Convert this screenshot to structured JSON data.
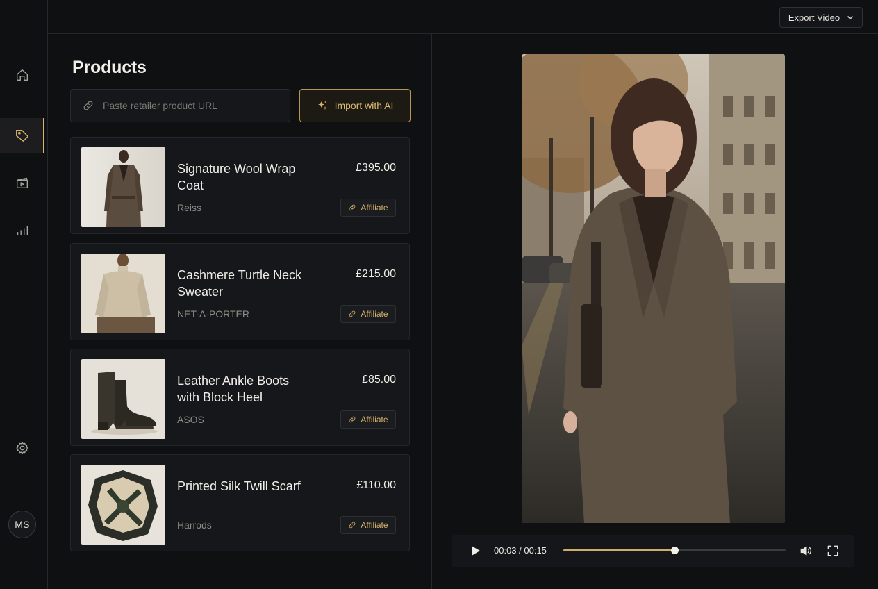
{
  "topbar": {
    "export_label": "Export Video",
    "export_icon": "chevron-down-icon"
  },
  "sidebar": {
    "items": [
      {
        "name": "home",
        "icon": "home-icon",
        "active": false
      },
      {
        "name": "products",
        "icon": "tag-icon",
        "active": true
      },
      {
        "name": "media",
        "icon": "clapperboard-icon",
        "active": false
      },
      {
        "name": "analytics",
        "icon": "bar-chart-icon",
        "active": false
      },
      {
        "name": "settings",
        "icon": "gear-icon",
        "active": false
      }
    ],
    "avatar_initials": "MS"
  },
  "products": {
    "title": "Products",
    "url_placeholder": "Paste retailer product URL",
    "url_value": "",
    "import_label": "Import with AI",
    "affiliate_label": "Affiliate",
    "items": [
      {
        "name": "Signature Wool Wrap Coat",
        "retailer": "Reiss",
        "price": "£395.00",
        "thumb": "wool-coat"
      },
      {
        "name": "Cashmere Turtle Neck Sweater",
        "retailer": "NET-A-PORTER",
        "price": "£215.00",
        "thumb": "turtleneck-sweater"
      },
      {
        "name": "Leather Ankle Boots with Block Heel",
        "retailer": "ASOS",
        "price": "£85.00",
        "thumb": "ankle-boots"
      },
      {
        "name": "Printed Silk Twill Scarf",
        "retailer": "Harrods",
        "price": "£110.00",
        "thumb": "silk-scarf"
      }
    ]
  },
  "player": {
    "timecode": "00:03 / 00:15",
    "progress": 0.5
  },
  "colors": {
    "accent": "#d8b36a",
    "background": "#0f1012",
    "card": "#16171a"
  }
}
